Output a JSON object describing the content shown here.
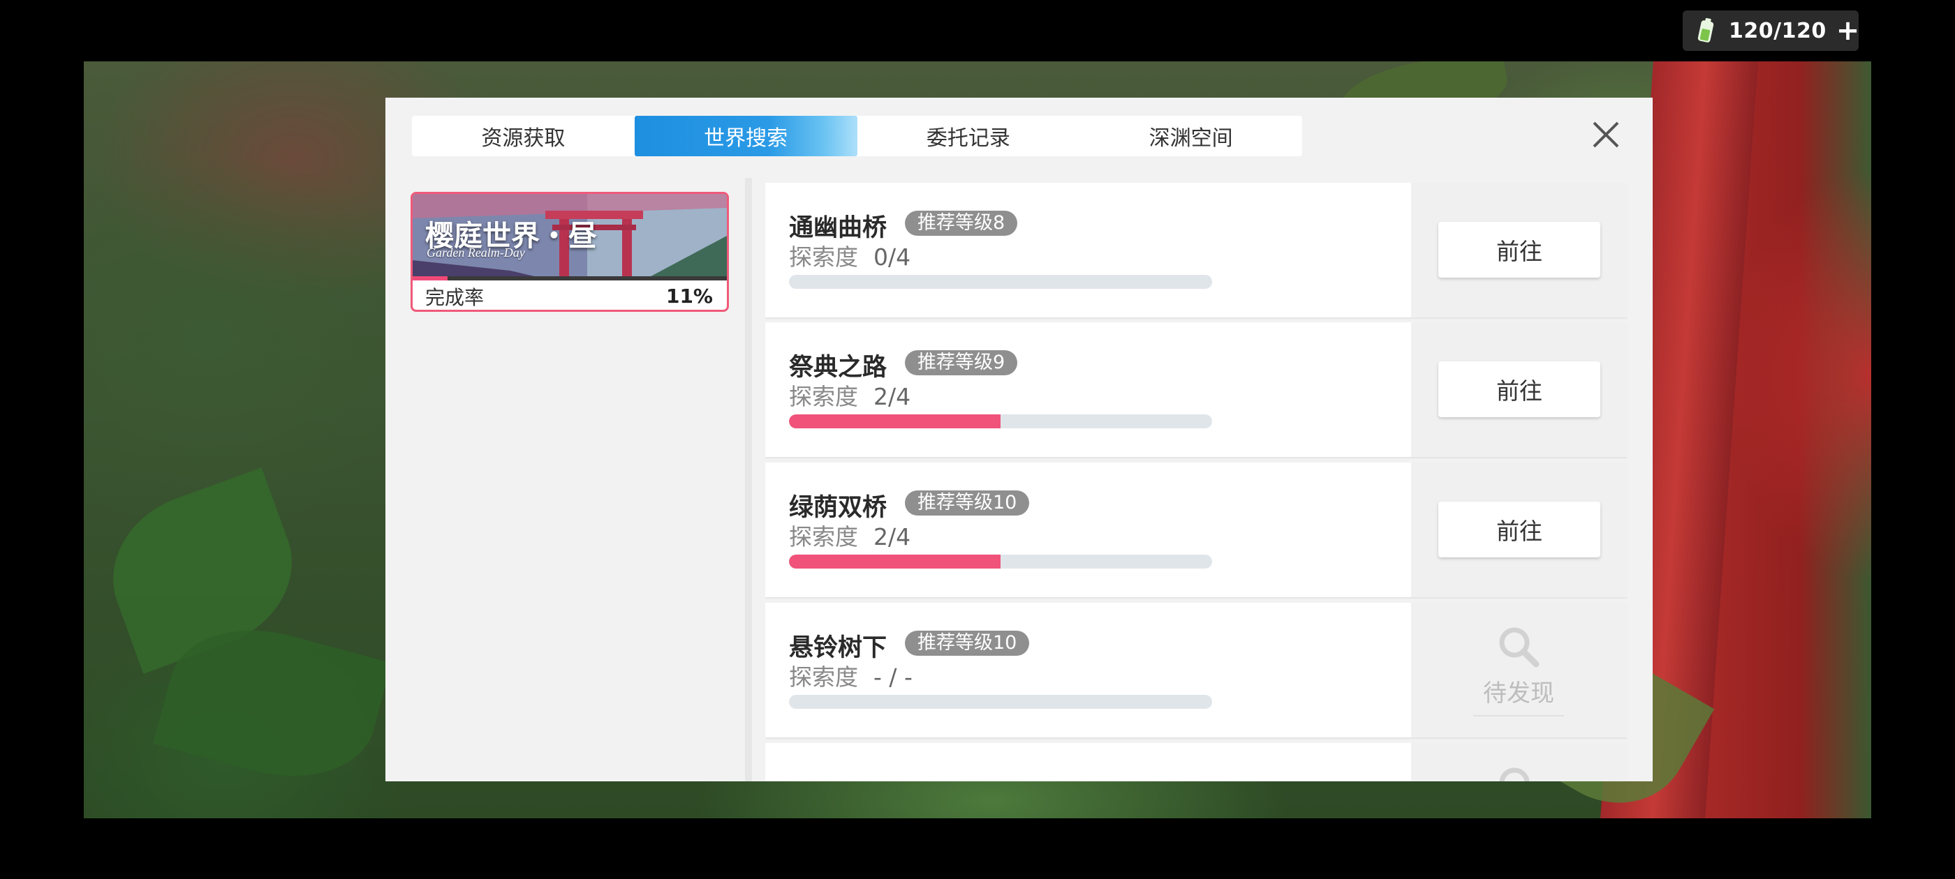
{
  "stamina": {
    "value": "120/120",
    "plus": "+",
    "icon": "battery-icon"
  },
  "tabs": [
    {
      "label": "资源获取",
      "active": false
    },
    {
      "label": "世界搜索",
      "active": true
    },
    {
      "label": "委托记录",
      "active": false
    },
    {
      "label": "深渊空间",
      "active": false
    }
  ],
  "region": {
    "title": "樱庭世界・昼",
    "subtitle": "Garden Realm-Day",
    "completion_label": "完成率",
    "completion_value": "11%",
    "completion_fraction": 0.11
  },
  "locations": [
    {
      "name": "通幽曲桥",
      "level": "推荐等级8",
      "progress_label": "探索度",
      "progress_text": "0/4",
      "progress_fraction": 0.0,
      "action": "前往",
      "discovered": true
    },
    {
      "name": "祭典之路",
      "level": "推荐等级9",
      "progress_label": "探索度",
      "progress_text": "2/4",
      "progress_fraction": 0.5,
      "action": "前往",
      "discovered": true
    },
    {
      "name": "绿荫双桥",
      "level": "推荐等级10",
      "progress_label": "探索度",
      "progress_text": "2/4",
      "progress_fraction": 0.5,
      "action": "前往",
      "discovered": true
    },
    {
      "name": "悬铃树下",
      "level": "推荐等级10",
      "progress_label": "探索度",
      "progress_text": "- / -",
      "progress_fraction": 0.0,
      "action": "待发现",
      "discovered": false
    },
    {
      "name": "",
      "level": "",
      "progress_label": "",
      "progress_text": "",
      "progress_fraction": 0.0,
      "action": "",
      "discovered": false
    }
  ],
  "colors": {
    "accent_blue": "#1e8fe0",
    "progress_pink": "#f0527a",
    "card_border": "#f05a7a"
  }
}
